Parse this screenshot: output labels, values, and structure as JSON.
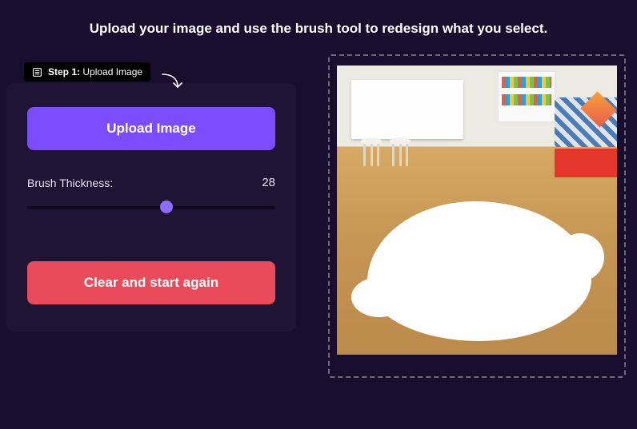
{
  "heading": "Upload your image and use the brush tool to redesign what you select.",
  "step": {
    "prefix": "Step 1:",
    "label": "Upload Image"
  },
  "buttons": {
    "upload": "Upload Image",
    "clear": "Clear and start again"
  },
  "brush": {
    "label": "Brush Thickness:",
    "value": "28",
    "percent": 56
  }
}
